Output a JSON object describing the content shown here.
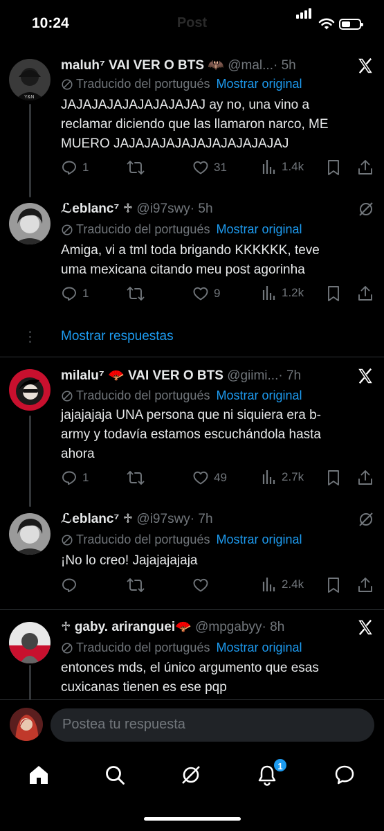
{
  "status": {
    "time": "10:24"
  },
  "header": {
    "title": "Post"
  },
  "common": {
    "translated_label": "Traducido del portugués",
    "show_original": "Mostrar original"
  },
  "posts": [
    {
      "name": "maluh⁷ VAI VER O BTS 🦇",
      "handle": "@mal...",
      "time": "· 5h",
      "text": "JAJAJAJAJAJAJAJAJAJ ay no, una vino a\nreclamar diciendo que las llamaron narco, ME\nMUERO JAJAJAJAJAJAJAJAJAJAJAJ",
      "replies": "1",
      "reposts": "",
      "likes": "31",
      "views": "1.4k"
    },
    {
      "name": "ℒeblanc⁷ ♱",
      "handle": "@i97swy",
      "time": "· 5h",
      "text": "Amiga, vi a tml toda brigando KKKKKK, teve\numa mexicana citando meu post agorinha",
      "replies": "1",
      "reposts": "",
      "likes": "9",
      "views": "1.2k"
    },
    {
      "name": "milalu⁷ 🪭 VAI VER O BTS",
      "handle": "@giimi...",
      "time": "· 7h",
      "text": "jajajajaja UNA persona que ni siquiera era b-\narmy y todavía estamos escuchándola hasta\nahora",
      "replies": "1",
      "reposts": "",
      "likes": "49",
      "views": "2.7k"
    },
    {
      "name": "ℒeblanc⁷ ♱",
      "handle": "@i97swy",
      "time": "· 7h",
      "text": "¡No lo creo! Jajajajajaja",
      "replies": "",
      "reposts": "",
      "likes": "",
      "views": "2.4k"
    },
    {
      "name": "♱ gaby. ariranguei🪭",
      "handle": "@mpgabyy",
      "time": "· 8h",
      "text": "entonces mds, el único argumento que esas\ncuxicanas tienen es ese pqp"
    }
  ],
  "more_replies": "Mostrar respuestas",
  "reply_bar": {
    "placeholder": "Postea tu respuesta"
  },
  "tabs": {
    "notifications_badge": "1"
  },
  "colors": {
    "accent": "#1d9bf0",
    "muted": "#71767b",
    "text": "#e7e9ea",
    "background": "#000000"
  }
}
